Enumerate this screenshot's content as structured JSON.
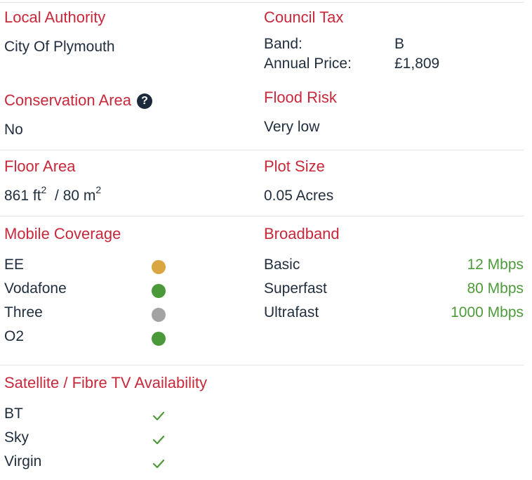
{
  "local_authority": {
    "label": "Local Authority",
    "value": "City Of Plymouth"
  },
  "council_tax": {
    "label": "Council Tax",
    "band_label": "Band:",
    "band_value": "B",
    "price_label": "Annual Price:",
    "price_value": "£1,809"
  },
  "conservation_area": {
    "label": "Conservation Area",
    "help_icon": "?",
    "value": "No"
  },
  "flood_risk": {
    "label": "Flood Risk",
    "value": "Very low"
  },
  "floor_area": {
    "label": "Floor Area",
    "ft_value": "861 ft",
    "ft_exp": "2",
    "separator": "/",
    "m_value": "80 m",
    "m_exp": "2"
  },
  "plot_size": {
    "label": "Plot Size",
    "value": "0.05 Acres"
  },
  "mobile_coverage": {
    "label": "Mobile Coverage",
    "networks": [
      {
        "name": "EE",
        "status_color": "#d9a642"
      },
      {
        "name": "Vodafone",
        "status_color": "#4a9a3a"
      },
      {
        "name": "Three",
        "status_color": "#a3a3a3"
      },
      {
        "name": "O2",
        "status_color": "#4a9a3a"
      }
    ]
  },
  "broadband": {
    "label": "Broadband",
    "tiers": [
      {
        "name": "Basic",
        "speed": "12 Mbps"
      },
      {
        "name": "Superfast",
        "speed": "80 Mbps"
      },
      {
        "name": "Ultrafast",
        "speed": "1000 Mbps"
      }
    ]
  },
  "tv_availability": {
    "label": "Satellite / Fibre TV Availability",
    "providers": [
      {
        "name": "BT",
        "icon": "check-icon"
      },
      {
        "name": "Sky",
        "icon": "check-icon"
      },
      {
        "name": "Virgin",
        "icon": "check-icon"
      }
    ]
  },
  "colors": {
    "heading": "#c8283a",
    "text": "#1f2d3d",
    "speed": "#4e9a3a",
    "divider": "#dfe3e6"
  }
}
